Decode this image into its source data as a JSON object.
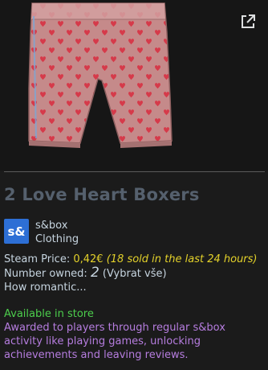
{
  "item": {
    "title": "2 Love Heart Boxers",
    "app_icon_text": "s&",
    "app_name": "s&box",
    "category": "Clothing",
    "price_label": "Steam Price:",
    "price": "0,42€",
    "price_note": "(18 sold in the last 24 hours)",
    "owned_label": "Number owned:",
    "owned_count": "2",
    "select_all": "(Vybrat vše)",
    "description": "How romantic...",
    "availability": "Available in store",
    "acquire_note": "Awarded to players through regular s&box activity like playing games, unlocking achievements and leaving reviews."
  },
  "colors": {
    "title": "#55606d",
    "price": "#e3d12a",
    "available": "#4cce4c",
    "acquire_note": "#b67ddf",
    "app_icon_bg": "#2d6fd5",
    "boxer_fabric": "#c58a8a",
    "boxer_hearts": "#d63a4a"
  },
  "icons": {
    "external": "external-link-icon"
  }
}
